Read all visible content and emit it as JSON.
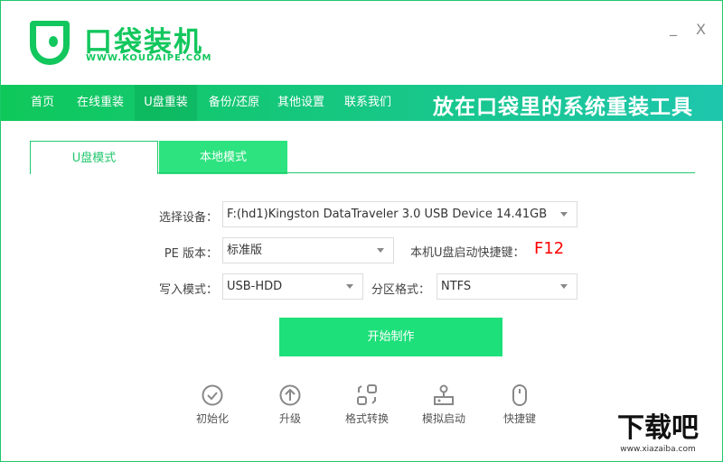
{
  "app": {
    "name": "口袋装机",
    "url": "WWW.KOUDAIPE.COM"
  },
  "window": {
    "minimize": "_",
    "close": "X"
  },
  "nav": {
    "items": [
      {
        "label": "首页"
      },
      {
        "label": "在线重装"
      },
      {
        "label": "U盘重装"
      },
      {
        "label": "备份/还原"
      },
      {
        "label": "其他设置"
      },
      {
        "label": "联系我们"
      }
    ],
    "active": 2,
    "slogan": "放在口袋里的系统重装工具"
  },
  "mode_tabs": [
    {
      "label": "U盘模式",
      "active": true
    },
    {
      "label": "本地模式",
      "active": false
    }
  ],
  "form": {
    "device_label": "选择设备：",
    "device_value": "F:(hd1)Kingston DataTraveler 3.0 USB Device 14.41GB",
    "pe_label": "PE 版本：",
    "pe_value": "标准版",
    "hotkey_label": "本机U盘启动快捷键：",
    "hotkey_value": "F12",
    "write_label": "写入模式：",
    "write_value": "USB-HDD",
    "partition_label": "分区格式：",
    "partition_value": "NTFS"
  },
  "start_button": "开始制作",
  "tools": [
    {
      "label": "初始化",
      "icon": "check-circle-icon"
    },
    {
      "label": "升级",
      "icon": "upgrade-icon"
    },
    {
      "label": "格式转换",
      "icon": "convert-icon"
    },
    {
      "label": "模拟启动",
      "icon": "stamp-icon"
    },
    {
      "label": "快捷键",
      "icon": "mouse-icon"
    }
  ],
  "watermark": {
    "text": "下载吧",
    "url": "www.xiazaiba.com"
  },
  "colors": {
    "brand": "#12c75d",
    "button": "#1ee07a",
    "hotkey": "#ff0000"
  }
}
